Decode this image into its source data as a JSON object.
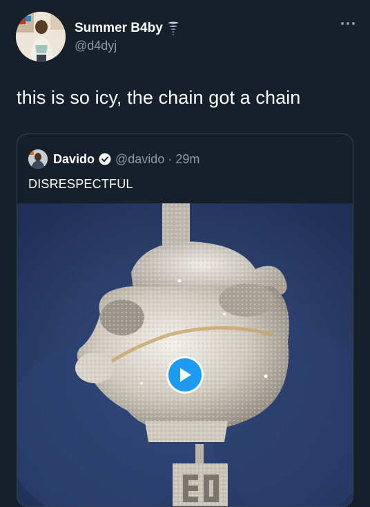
{
  "tweet": {
    "author_name": "Summer B4by",
    "author_emoji_icon": "tornado-icon",
    "author_handle": "@d4dyj",
    "text": "this is so icy, the chain got a chain",
    "more_icon": "more-options-icon"
  },
  "quoted_tweet": {
    "author_name": "Davido",
    "verified_icon": "verified-badge-icon",
    "meta": "@davido · 29m",
    "text": "DISRESPECTFUL",
    "media_type": "video",
    "play_icon": "play-icon"
  },
  "colors": {
    "background": "#15202b",
    "secondary_text": "#8b98a5",
    "border": "#38444d",
    "accent": "#1d9bf0"
  }
}
